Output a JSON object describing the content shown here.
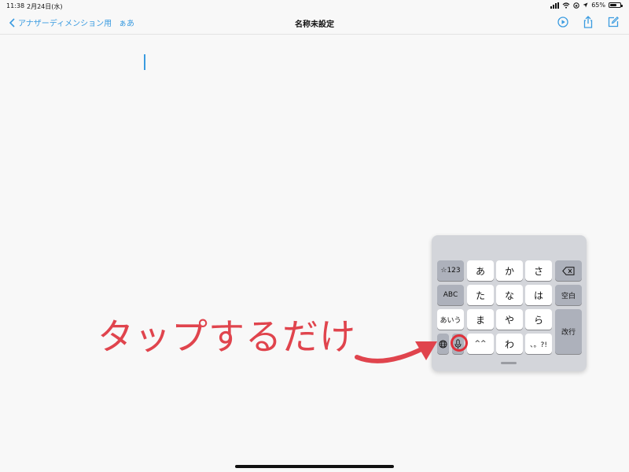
{
  "status_bar": {
    "time": "11:38",
    "date": "2月24日(水)",
    "battery": "65%",
    "battery_level": 0.65
  },
  "nav": {
    "back_label": "アナザーディメンション用",
    "aa_label": "ぁあ",
    "title": "名称未設定",
    "icons": [
      "play-circle-icon",
      "share-icon",
      "compose-icon"
    ]
  },
  "keyboard": {
    "row1": [
      "☆123",
      "あ",
      "か",
      "さ"
    ],
    "row2": [
      "ABC",
      "た",
      "な",
      "は",
      "空白"
    ],
    "row3": [
      "あいう",
      "ま",
      "や",
      "ら",
      "改行"
    ],
    "row4": [
      "^^",
      "わ",
      "、。?!"
    ],
    "icons": [
      "backspace-icon",
      "globe-icon",
      "microphone-icon"
    ]
  },
  "annotation": {
    "text": "タップするだけ",
    "color": "#e0444d"
  },
  "colors": {
    "accent": "#3a9be0",
    "annotation": "#e0444d"
  }
}
